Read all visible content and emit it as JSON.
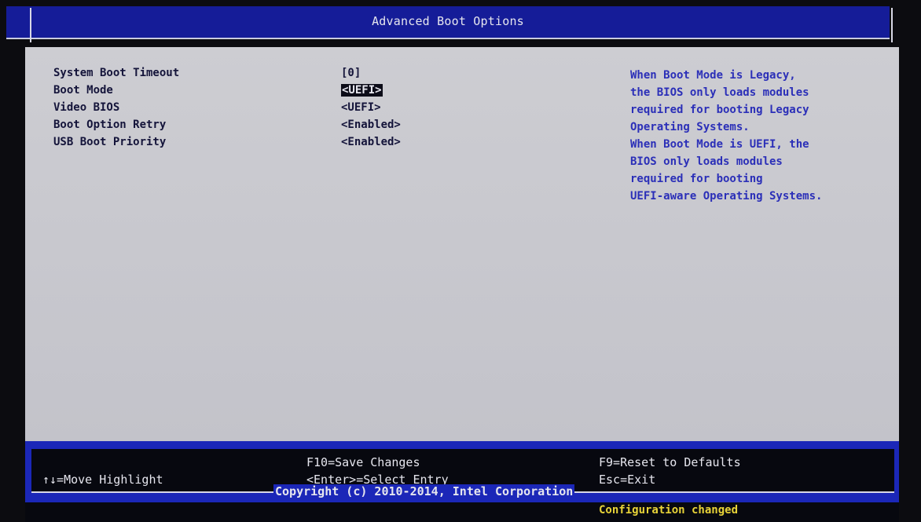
{
  "title": "Advanced Boot Options",
  "settings": [
    {
      "label": "System Boot Timeout",
      "value": "[0]"
    },
    {
      "label": "Boot Mode",
      "value": "<UEFI>"
    },
    {
      "label": "Video BIOS",
      "value": "<UEFI>"
    },
    {
      "label": "Boot Option Retry",
      "value": "<Enabled>"
    },
    {
      "label": "USB Boot Priority",
      "value": "<Enabled>"
    }
  ],
  "help": [
    "When Boot Mode is Legacy,",
    "the BIOS only loads modules",
    "required for booting Legacy",
    "Operating Systems.",
    "When Boot Mode is UEFI, the",
    "BIOS only loads modules",
    "required for booting",
    "UEFI-aware Operating Systems."
  ],
  "footer": {
    "move_highlight": "↑↓=Move Highlight",
    "save_changes": "F10=Save Changes",
    "select_entry": "<Enter>=Select Entry",
    "reset_defaults": "F9=Reset to Defaults",
    "exit": "Esc=Exit",
    "copyright": "Copyright (c) 2010-2014, Intel Corporation"
  },
  "status": "Configuration changed",
  "colors": {
    "title_bar": "#151c98",
    "panel": "#c9c9cf",
    "help_text": "#2b2fb8",
    "status_text": "#e8d338"
  }
}
